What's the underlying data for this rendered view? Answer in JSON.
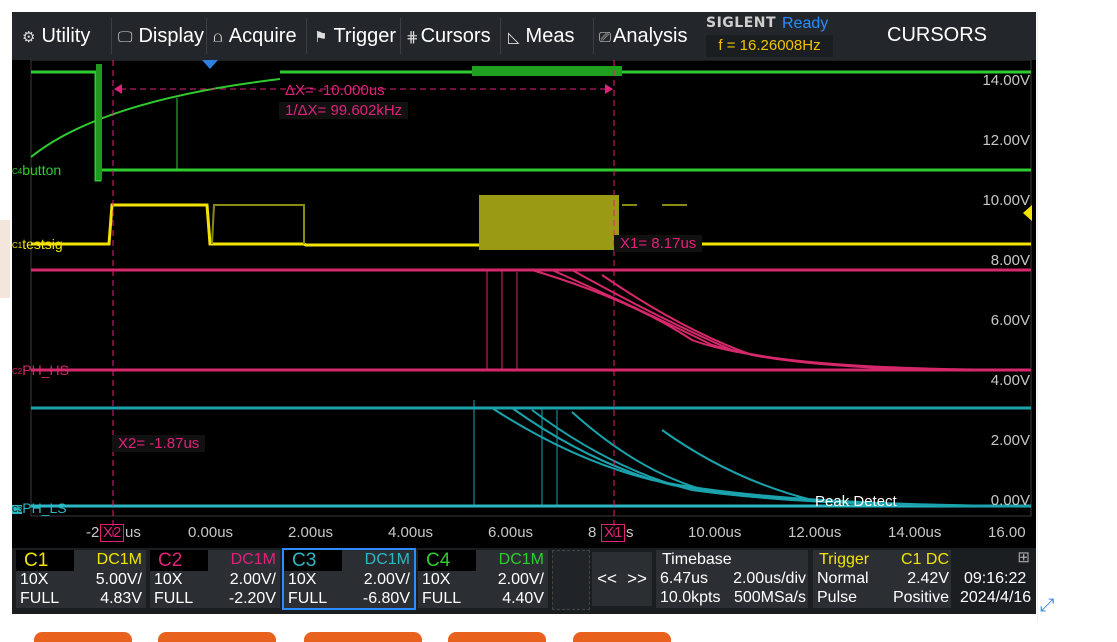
{
  "menu": {
    "items": [
      {
        "label": "Utility",
        "icon": "gear-icon"
      },
      {
        "label": "Display",
        "icon": "monitor-icon"
      },
      {
        "label": "Acquire",
        "icon": "acquire-icon"
      },
      {
        "label": "Trigger",
        "icon": "trigger-icon"
      },
      {
        "label": "Cursors",
        "icon": "cursors-icon"
      },
      {
        "label": "Meas",
        "icon": "measure-icon"
      },
      {
        "label": "Analysis",
        "icon": "analysis-icon"
      }
    ],
    "logo": "SIGLENT",
    "status": "Ready",
    "frequency": "f = 16.26008Hz",
    "mode": "CURSORS"
  },
  "plot": {
    "voltage_labels": [
      "14.00V",
      "12.00V",
      "10.00V",
      "8.00V",
      "6.00V",
      "4.00V",
      "2.00V",
      "0.00V"
    ],
    "time_labels": [
      "-2",
      "us",
      "0.00us",
      "2.00us",
      "4.00us",
      "6.00us",
      "8",
      "s",
      "10.00us",
      "12.00us",
      "14.00us",
      "16.00"
    ],
    "channel_tags": [
      {
        "num": "C4",
        "name": "button",
        "color": "#2ecc2e"
      },
      {
        "num": "C1",
        "name": "testsig",
        "color": "#f2e400"
      },
      {
        "num": "C2",
        "name": "PH_HS",
        "color": "#d6286b"
      },
      {
        "num": "C3",
        "name": "PH_LS",
        "color": "#2bb8c4"
      }
    ],
    "cursors": {
      "delta": "ΔX= -10.000us",
      "inv_delta": "1/ΔX= 99.602kHz",
      "x1": "X1= 8.17us",
      "x2": "X2= -1.87us",
      "x1_tag": "X1",
      "x2_tag": "X2"
    },
    "acq_mode": "Peak Detect"
  },
  "channels": [
    {
      "name": "C1",
      "color": "#f2e400",
      "coupling": "DC1M",
      "probe": "10X",
      "scale": "5.00V/",
      "bw": "FULL",
      "offset": "4.83V"
    },
    {
      "name": "C2",
      "color": "#e0217a",
      "coupling": "DC1M",
      "probe": "10X",
      "scale": "2.00V/",
      "bw": "FULL",
      "offset": "-2.20V"
    },
    {
      "name": "C3",
      "color": "#2bb8c4",
      "coupling": "DC1M",
      "probe": "10X",
      "scale": "2.00V/",
      "bw": "FULL",
      "offset": "-6.80V"
    },
    {
      "name": "C4",
      "color": "#2ecc2e",
      "coupling": "DC1M",
      "probe": "10X",
      "scale": "2.00V/",
      "bw": "FULL",
      "offset": "4.40V"
    }
  ],
  "nav": {
    "prev": "<<",
    "next": ">>"
  },
  "timebase": {
    "title": "Timebase",
    "delay": "6.47us",
    "scale": "2.00us/div",
    "points": "10.0kpts",
    "rate": "500MSa/s"
  },
  "trigger": {
    "title": "Trigger",
    "source": "C1 DC",
    "mode": "Normal",
    "level": "2.42V",
    "type": "Pulse",
    "slope": "Positive"
  },
  "clock": {
    "time": "09:16:22",
    "date": "2024/4/16"
  }
}
